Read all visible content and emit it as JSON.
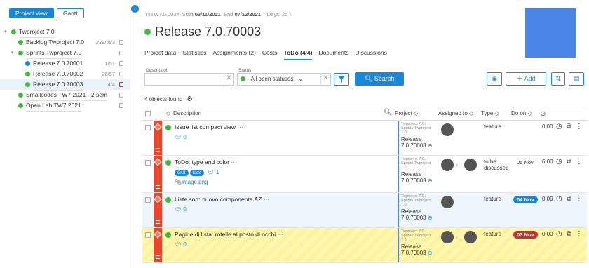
{
  "left": {
    "project_view_label": "Project view",
    "gantt_label": "Gantt",
    "tree": [
      {
        "label": "Twproject 7.0",
        "level": 0,
        "color": "#44b53e",
        "count": "",
        "caret": "▾"
      },
      {
        "label": "Backlog Twproject 7.0",
        "level": 1,
        "color": "#44b53e",
        "count": "238/283",
        "caret": ""
      },
      {
        "label": "Sprints Twproject 7.0",
        "level": 1,
        "color": "#44b53e",
        "count": "",
        "caret": "▾"
      },
      {
        "label": "Release 7.0.70001",
        "level": 2,
        "color": "#1a86d6",
        "count": "1/51",
        "caret": ""
      },
      {
        "label": "Release 7.0.70002",
        "level": 2,
        "color": "#44b53e",
        "count": "26/57",
        "caret": ""
      },
      {
        "label": "Release 7.0.70003",
        "level": 2,
        "color": "#44b53e",
        "count": "4/4",
        "caret": ""
      },
      {
        "label": "Smallcodes TW7 2021 - 2 sem",
        "level": 1,
        "color": "#44b53e",
        "count": "",
        "caret": ""
      },
      {
        "label": "Open Lab TW7 2021",
        "level": 1,
        "color": "#44b53e",
        "count": "",
        "caret": ""
      }
    ]
  },
  "header": {
    "code": "T#TW7.0.003#",
    "start_label": "Start",
    "start": "03/11/2021",
    "end_label": "End",
    "end": "07/12/2021",
    "days": "(Days: 25 )",
    "title": "Release 7.0.70003"
  },
  "tabs": [
    "Project data",
    "Statistics",
    "Assignments (2)",
    "Costs",
    "ToDo (4/4)",
    "Documents",
    "Discussions"
  ],
  "filters": {
    "description_label": "Description",
    "status_label": "Status",
    "status_value": "- All open statuses -",
    "search_label": "Search",
    "add_label": "Add"
  },
  "count_text": "4 objects found",
  "columns": {
    "description": "Description",
    "project": "Project",
    "assigned": "Assigned to",
    "type": "Type",
    "do_on": "Do on"
  },
  "rows": [
    {
      "desc": "Issue list compact view",
      "comments": "0",
      "tags": [],
      "attachment": "",
      "proj_path": "Twproject 7.0 / Sprints Twproject 7.0",
      "release": "Release",
      "release_num": "7.0.70003",
      "type": "feature",
      "type2": "",
      "date": "",
      "date_color": "",
      "time": "0:00"
    },
    {
      "desc": "ToDo: type and color",
      "comments": "1",
      "tags": [
        "GUI",
        "todo"
      ],
      "attachment": "image.png",
      "proj_path": "Twproject 7.0 / Sprints Twproject 7.0",
      "release": "Release",
      "release_num": "7.0.70003",
      "type": "to be",
      "type2": "discussed",
      "date": "05 Nov",
      "date_color": "",
      "time": "6:00"
    },
    {
      "desc": "Liste sort: nuovo componente AZ",
      "comments": "0",
      "tags": [],
      "attachment": "",
      "proj_path": "Twproject 7.0 / Sprints Twproject 7.0",
      "release": "Release",
      "release_num": "7.0.70003",
      "type": "feature",
      "type2": "",
      "date": "04 Nov",
      "date_color": "#1a86d6",
      "time": "0:00"
    },
    {
      "desc": "Pagine di lista: rotelle al posto di occhi",
      "comments": "0",
      "tags": [],
      "attachment": "",
      "proj_path": "Twproject 7.0 / Sprints Twproject 7.0",
      "release": "Release",
      "release_num": "7.0.70003",
      "type": "feature",
      "type2": "",
      "date": "03 Nov",
      "date_color": "#c9302c",
      "time": "0:00"
    }
  ]
}
